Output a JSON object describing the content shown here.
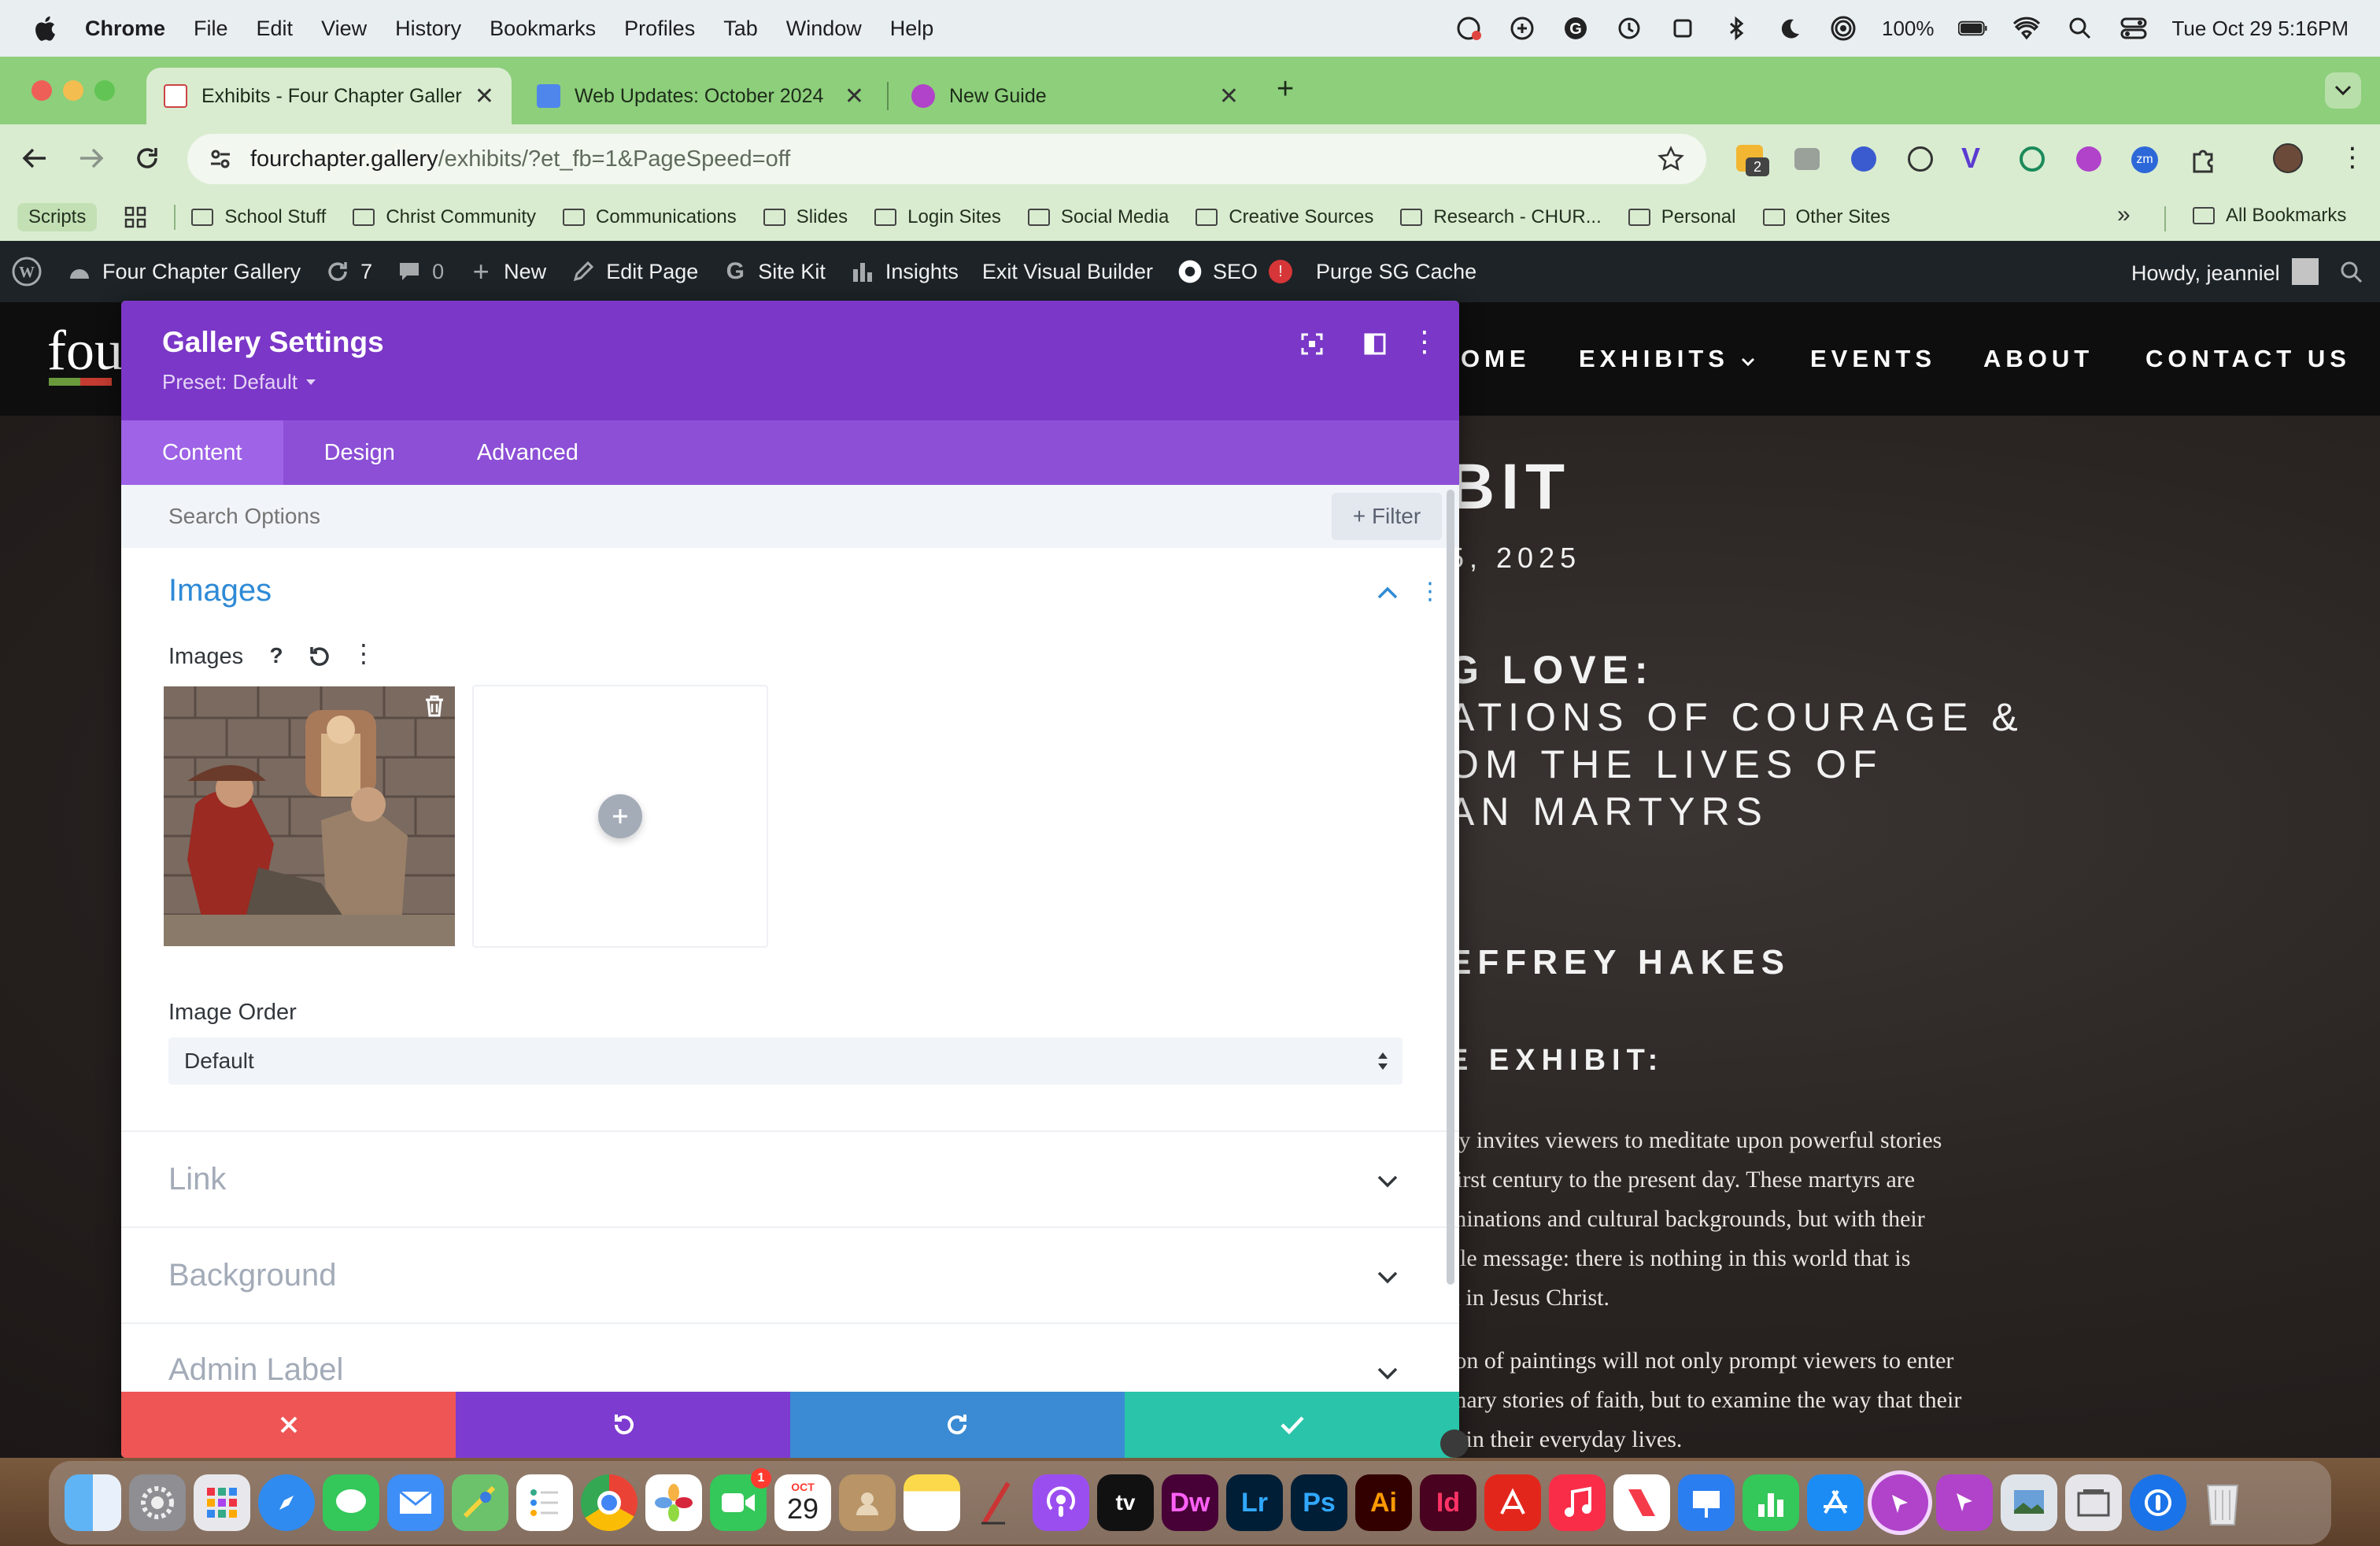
{
  "menubar": {
    "items": [
      "Chrome",
      "File",
      "Edit",
      "View",
      "History",
      "Bookmarks",
      "Profiles",
      "Tab",
      "Window",
      "Help"
    ],
    "battery": "100%",
    "clock": "Tue Oct 29  5:16PM"
  },
  "browser": {
    "tabs": [
      {
        "title": "Exhibits - Four Chapter Galler",
        "favicon": "gallery-favicon"
      },
      {
        "title": "Web Updates: October 2024",
        "favicon": "docs-icon"
      },
      {
        "title": "New Guide",
        "favicon": "scribe-icon"
      }
    ],
    "url_host": "fourchapter.gallery",
    "url_path": "/exhibits/?et_fb=1&PageSpeed=off",
    "extension_badge": "2",
    "bookmarks": [
      "Scripts",
      "School Stuff",
      "Christ Community",
      "Communications",
      "Slides",
      "Login Sites",
      "Social Media",
      "Creative Sources",
      "Research - CHUR...",
      "Personal",
      "Other Sites"
    ],
    "bookmarks_overflow": "»",
    "all_bookmarks": "All Bookmarks"
  },
  "wpbar": {
    "site_name": "Four Chapter Gallery",
    "updates": "7",
    "comments": "0",
    "new": "New",
    "edit_page": "Edit Page",
    "site_kit": "Site Kit",
    "insights": "Insights",
    "exit_builder": "Exit Visual Builder",
    "seo": "SEO",
    "seo_badge": "!",
    "purge": "Purge SG Cache",
    "howdy": "Howdy, jeanniel"
  },
  "site": {
    "logo_text": "fou",
    "nav": [
      "OME",
      "EXHIBITS",
      "EVENTS",
      "ABOUT",
      "CONTACT US"
    ],
    "heading_1": "BIT",
    "date": "5, 2025",
    "title_lines": [
      "G LOVE:",
      "ATIONS OF COURAGE &",
      "OM THE LIVES OF",
      "AN MARTYRS"
    ],
    "artist": "EFFREY HAKES",
    "about": "E EXHIBIT:",
    "para1": [
      "ey invites viewers to meditate upon powerful stories",
      "first century to the present day. These martyrs are",
      "minations and cultural backgrounds, but with their",
      "ble message: there is nothing in this world that is",
      "n in Jesus Christ."
    ],
    "para2": [
      "ion of paintings will not only prompt viewers to enter",
      "inary stories of faith, but to examine the way that their",
      "d in their everyday lives."
    ]
  },
  "panel": {
    "title": "Gallery Settings",
    "preset": "Preset: Default",
    "tabs": [
      "Content",
      "Design",
      "Advanced"
    ],
    "search_placeholder": "Search Options",
    "filter": "+ Filter",
    "sections": {
      "images": "Images",
      "images_label": "Images",
      "help": "?",
      "image_order_label": "Image Order",
      "image_order_value": "Default",
      "link": "Link",
      "background": "Background",
      "admin_label": "Admin Label"
    }
  },
  "dock": {
    "calendar_month": "OCT",
    "calendar_day": "29",
    "facetime_badge": "1",
    "apps": [
      "finder-icon",
      "system-settings-icon",
      "launchpad-icon",
      "safari-icon",
      "messages-icon",
      "mail-icon",
      "maps-icon",
      "reminders-icon",
      "chrome-icon",
      "photos-icon",
      "facetime-icon",
      "calendar-icon",
      "contacts-icon",
      "notes-icon",
      "pen-icon",
      "podcasts-icon",
      "appletv-icon",
      "dreamweaver-icon",
      "lightroom-icon",
      "photoshop-icon",
      "illustrator-icon",
      "indesign-icon",
      "acrobat-icon",
      "music-icon",
      "news-icon",
      "keynote-icon",
      "numbers-icon",
      "appstore-icon",
      "scribe-icon",
      "scribe-business-icon",
      "preview-icon",
      "gallery-icon",
      "1password-icon",
      "trash-icon"
    ],
    "labels": {
      "tv": "tv",
      "dw": "Dw",
      "lr": "Lr",
      "ps": "Ps",
      "ai": "Ai",
      "id": "Id"
    }
  }
}
